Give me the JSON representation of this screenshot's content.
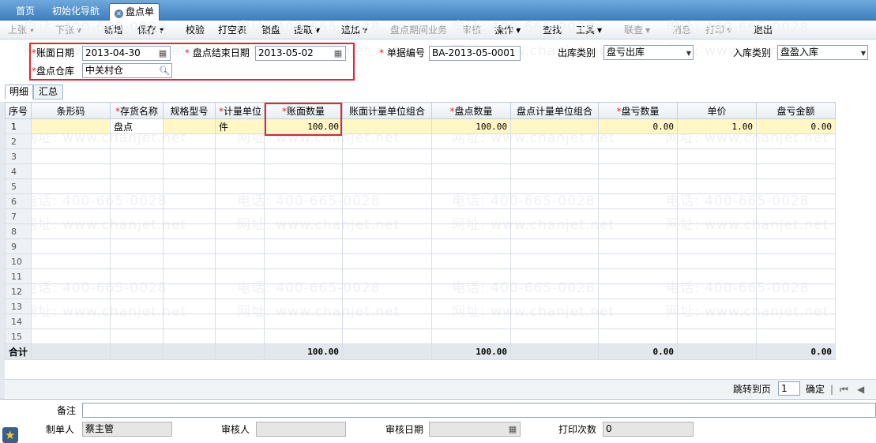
{
  "tabs": [
    {
      "label": "首页"
    },
    {
      "label": "初始化导航"
    },
    {
      "label": "盘点单"
    }
  ],
  "toolbar": {
    "prev": "上张",
    "next": "下张",
    "new": "新增",
    "save": "保存",
    "check": "校验",
    "print_empty": "打空表",
    "lock": "锁盘",
    "extract": "提取",
    "append": "追加",
    "period_business": "盘点期间业务",
    "audit": "审核",
    "operate": "操作",
    "find": "查找",
    "tools": "工具",
    "linked_query": "联查",
    "message": "消息",
    "print": "打印",
    "exit": "退出"
  },
  "watermark": {
    "phone": "电话: 400-665-0028",
    "site": "网址: www.chanjet.net"
  },
  "header": {
    "book_date_label": "账面日期",
    "book_date_value": "2013-04-30",
    "end_date_label": "盘点结束日期",
    "end_date_value": "2013-05-02",
    "doc_no_label": "单据编号",
    "doc_no_value": "BA-2013-05-0001",
    "out_type_label": "出库类别",
    "out_type_value": "盘亏出库",
    "in_type_label": "入库类别",
    "in_type_value": "盘盈入库",
    "warehouse_label": "盘点仓库",
    "warehouse_value": "中关村仓",
    "required_mark": "*"
  },
  "subtabs": {
    "detail": "明细",
    "summary": "汇总"
  },
  "grid": {
    "columns": [
      "序号",
      "条形码",
      "存货名称",
      "规格型号",
      "计量单位",
      "账面数量",
      "账面计量单位组合",
      "盘点数量",
      "盘点计量单位组合",
      "盘亏数量",
      "单价",
      "盘亏金额"
    ],
    "row1": {
      "seq": "1",
      "barcode": "",
      "name": "盘点",
      "spec": "",
      "unit": "件",
      "book_qty": "100.00",
      "book_combo": "",
      "count_qty": "100.00",
      "count_combo": "",
      "loss_qty": "0.00",
      "price": "1.00",
      "loss_amt": "0.00"
    },
    "empty_rows": [
      "2",
      "3",
      "4",
      "5",
      "6",
      "7",
      "8",
      "9",
      "10",
      "11",
      "12",
      "13",
      "14",
      "15"
    ],
    "totals": {
      "label": "合计",
      "book_qty": "100.00",
      "count_qty": "100.00",
      "loss_qty": "0.00",
      "loss_amt": "0.00"
    }
  },
  "pager": {
    "goto_label": "跳转到页",
    "page_value": "1",
    "confirm": "确定"
  },
  "footer": {
    "remark_label": "备注",
    "maker_label": "制单人",
    "maker_value": "蔡主管",
    "auditor_label": "审核人",
    "audit_date_label": "审核日期",
    "print_count_label": "打印次数",
    "print_count_value": "0"
  }
}
